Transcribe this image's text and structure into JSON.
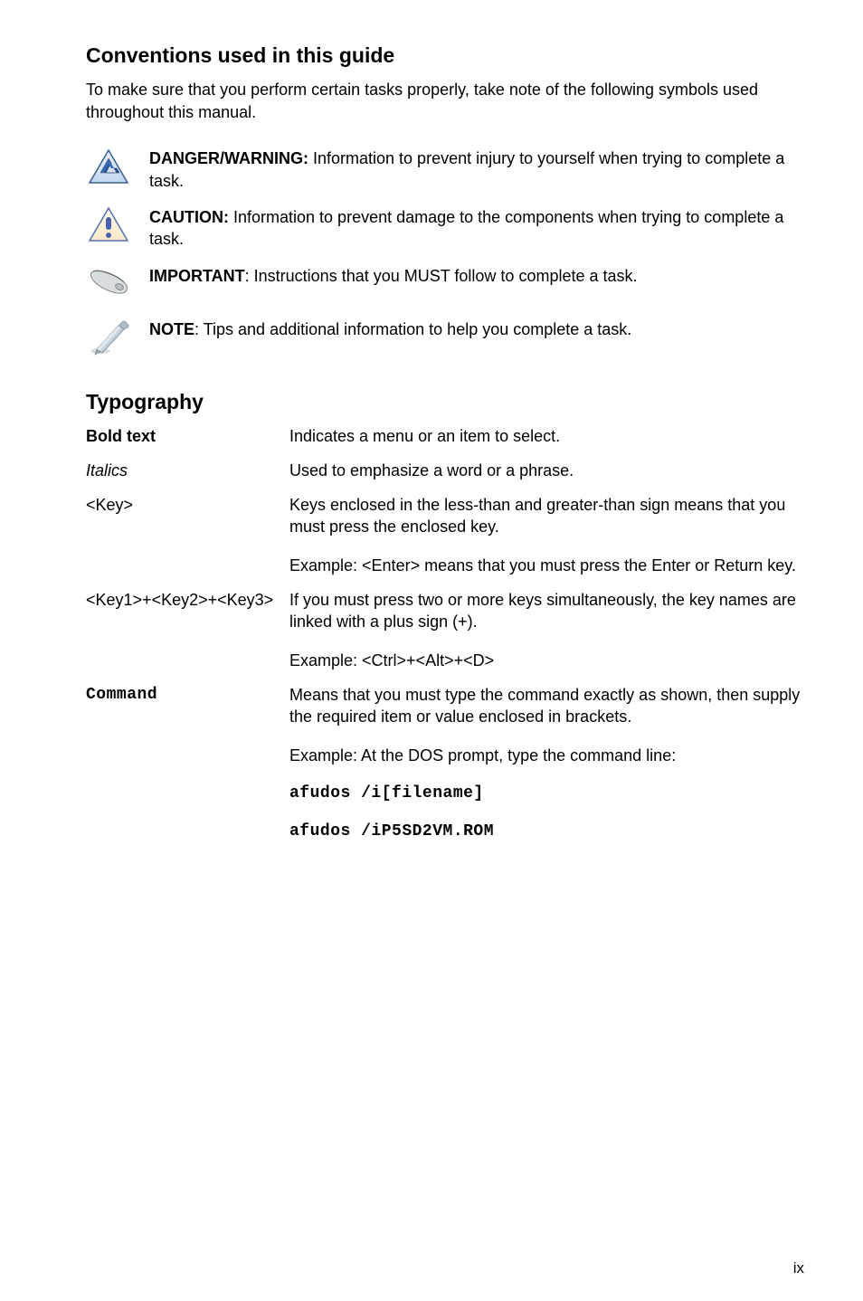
{
  "section1": {
    "title": "Conventions used in this guide",
    "intro": "To make sure that you perform certain tasks properly, take note of the following symbols used throughout this manual.",
    "notices": [
      {
        "icon": "danger-icon",
        "label": "DANGER/WARNING:",
        "text": " Information to prevent injury to yourself when trying to complete a task."
      },
      {
        "icon": "caution-icon",
        "label": "CAUTION:",
        "text": " Information to prevent damage to the components when trying to complete a task."
      },
      {
        "icon": "important-icon",
        "label": "IMPORTANT",
        "text": ": Instructions that you MUST follow to complete a task."
      },
      {
        "icon": "note-icon",
        "label": "NOTE",
        "text": ": Tips and additional information to help you complete a task."
      }
    ]
  },
  "section2": {
    "title": "Typography",
    "rows": [
      {
        "term": "Bold text",
        "termStyle": "bold",
        "def": "Indicates a menu or an item to select."
      },
      {
        "term": "Italics",
        "termStyle": "italic",
        "def": "Used to emphasize a word or a phrase."
      },
      {
        "term": "<Key>",
        "termStyle": "",
        "def": "Keys enclosed in the less-than and greater-than sign means that you must press the enclosed key.",
        "extra1": "Example: <Enter> means that you must press the Enter or Return key."
      },
      {
        "term": "<Key1>+<Key2>+<Key3>",
        "termStyle": "",
        "def": "If you must press two or more keys simultaneously, the key names are linked with a plus sign (+).",
        "extra1": "Example: <Ctrl>+<Alt>+<D>"
      },
      {
        "term": "Command",
        "termStyle": "mono",
        "def": "Means that you must type the command exactly as shown, then supply the required item or value enclosed in brackets.",
        "extra1": "Example: At the DOS prompt, type the command line:",
        "extra2": "afudos /i[filename]",
        "extra3": "afudos /iP5SD2VM.ROM"
      }
    ]
  },
  "pageNumber": "ix"
}
